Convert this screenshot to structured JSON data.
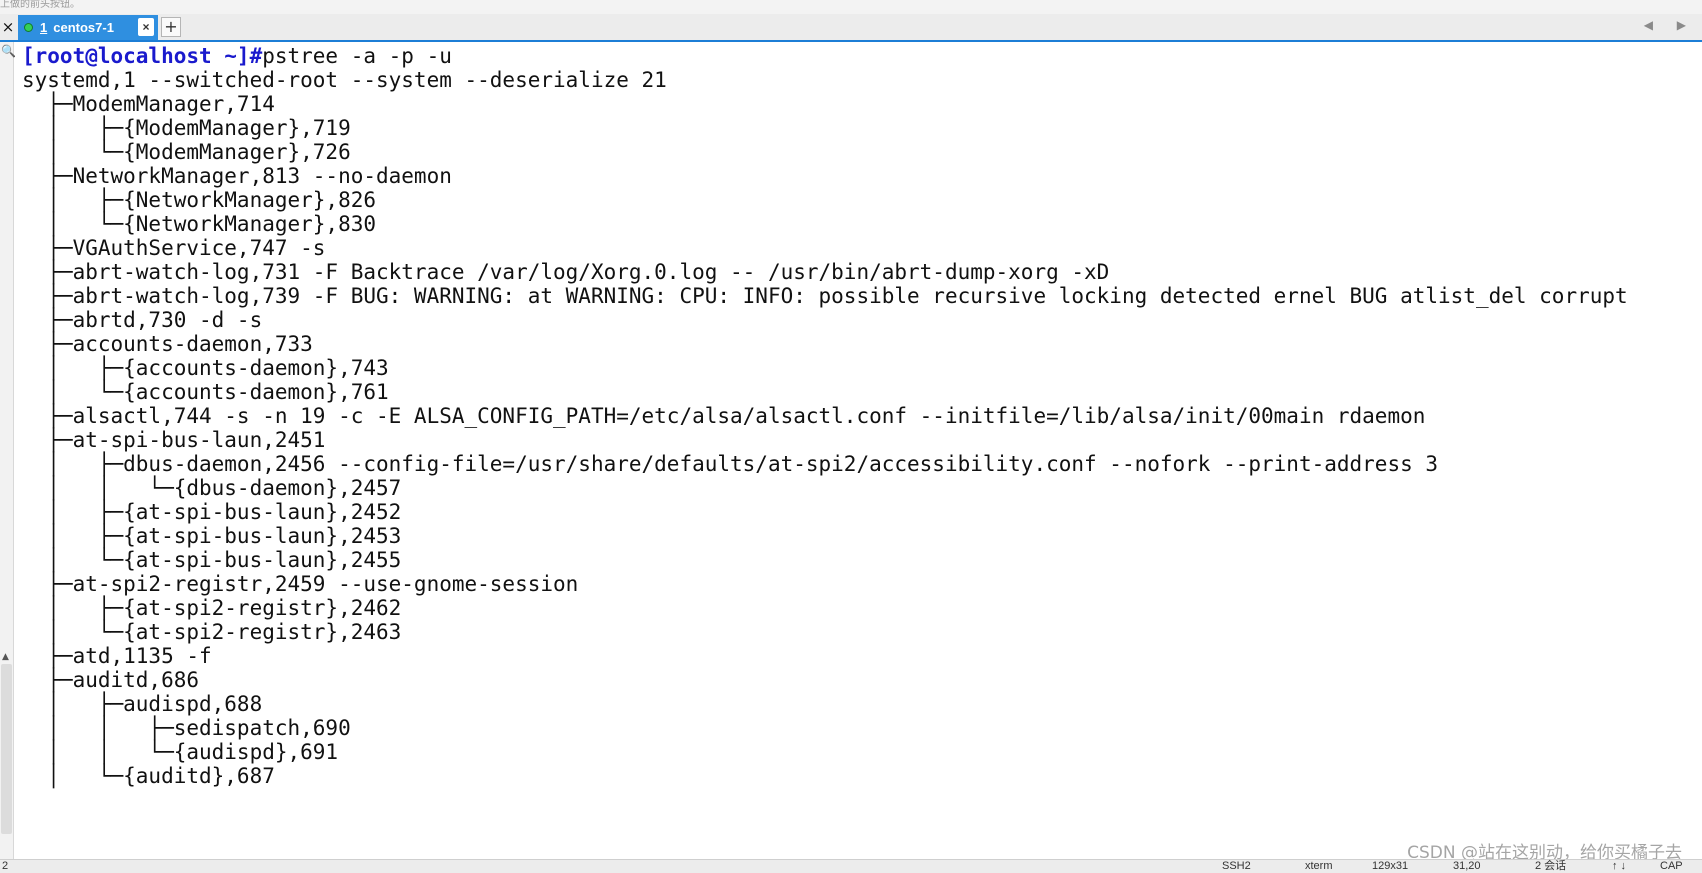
{
  "top_strip_text": "上做的前头按钮。",
  "tab": {
    "number": "1",
    "title": "centos7-1",
    "close_symbol": "×",
    "add_symbol": "+"
  },
  "window_close_symbol": "×",
  "tab_nav_symbols": "◀ ▶",
  "left_strip": {
    "search_symbol": "🔍",
    "scroll_up_symbol": "▲"
  },
  "terminal": {
    "prompt": "[root@localhost ~]#",
    "command": "pstree -a -p -u",
    "lines": [
      "systemd,1 --switched-root --system --deserialize 21",
      "  ├─ModemManager,714",
      "  │   ├─{ModemManager},719",
      "  │   └─{ModemManager},726",
      "  ├─NetworkManager,813 --no-daemon",
      "  │   ├─{NetworkManager},826",
      "  │   └─{NetworkManager},830",
      "  ├─VGAuthService,747 -s",
      "  ├─abrt-watch-log,731 -F Backtrace /var/log/Xorg.0.log -- /usr/bin/abrt-dump-xorg -xD",
      "  ├─abrt-watch-log,739 -F BUG: WARNING: at WARNING: CPU: INFO: possible recursive locking detected ernel BUG atlist_del corrupt",
      "  ├─abrtd,730 -d -s",
      "  ├─accounts-daemon,733",
      "  │   ├─{accounts-daemon},743",
      "  │   └─{accounts-daemon},761",
      "  ├─alsactl,744 -s -n 19 -c -E ALSA_CONFIG_PATH=/etc/alsa/alsactl.conf --initfile=/lib/alsa/init/00main rdaemon",
      "  ├─at-spi-bus-laun,2451",
      "  │   ├─dbus-daemon,2456 --config-file=/usr/share/defaults/at-spi2/accessibility.conf --nofork --print-address 3",
      "  │   │   └─{dbus-daemon},2457",
      "  │   ├─{at-spi-bus-laun},2452",
      "  │   ├─{at-spi-bus-laun},2453",
      "  │   └─{at-spi-bus-laun},2455",
      "  ├─at-spi2-registr,2459 --use-gnome-session",
      "  │   ├─{at-spi2-registr},2462",
      "  │   └─{at-spi2-registr},2463",
      "  ├─atd,1135 -f",
      "  ├─auditd,686",
      "  │   ├─audispd,688",
      "  │   │   ├─sedispatch,690",
      "  │   │   └─{audispd},691",
      "  │   └─{auditd},687"
    ]
  },
  "status": {
    "left": "2",
    "protocol": "SSH2",
    "terminal_type": "xterm",
    "size": "129x31",
    "cursor": "31,20",
    "sessions": "2 会话",
    "arrows": "↑ ↓",
    "caps": "CAP"
  },
  "watermark": "CSDN @站在这别动，给你买橘子去",
  "colors": {
    "accent": "#2f8fe0",
    "prompt": "#1a1acd",
    "text": "#111111"
  }
}
